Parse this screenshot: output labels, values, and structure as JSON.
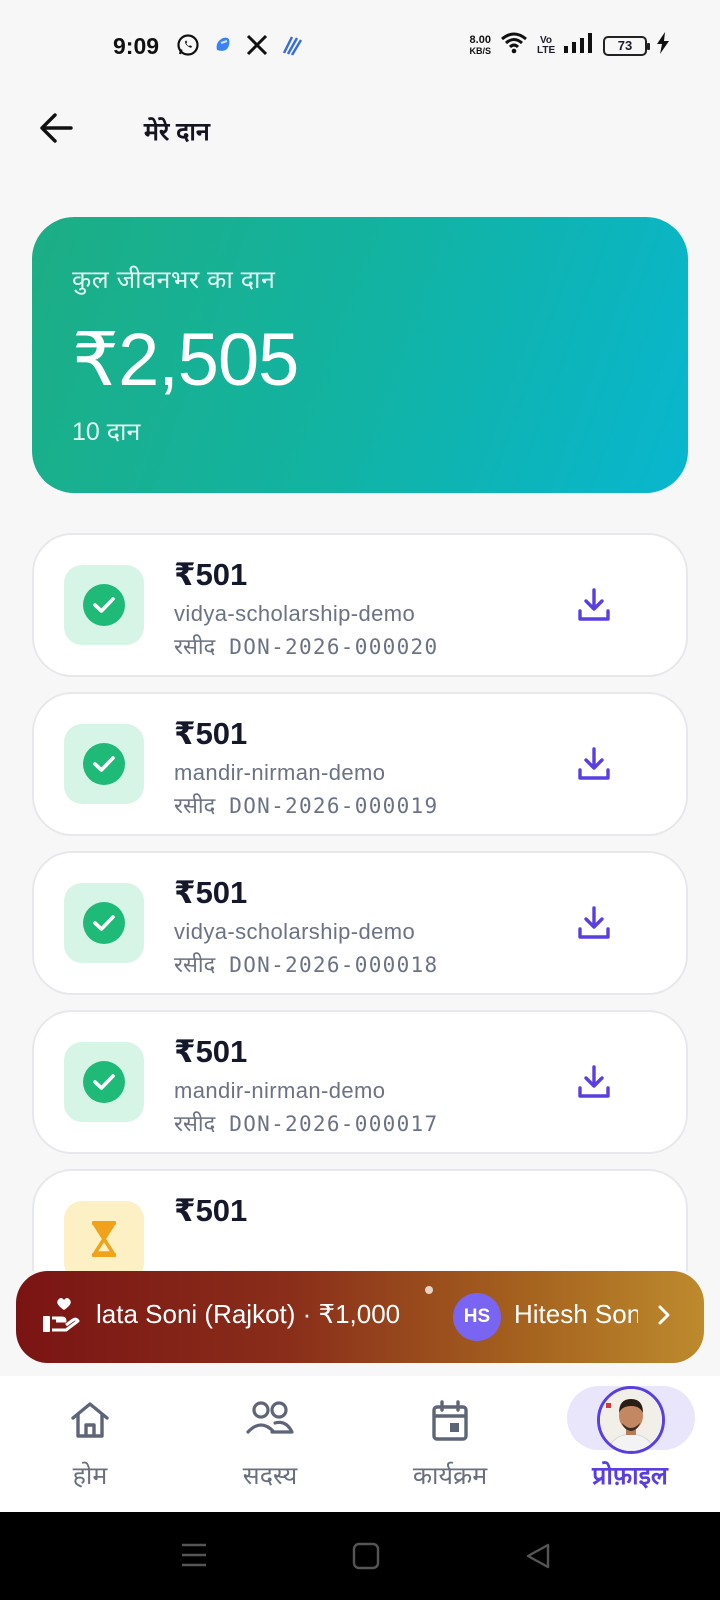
{
  "status_bar": {
    "time": "9:09",
    "net_speed_value": "8.00",
    "net_speed_unit": "KB/S",
    "volte": "Vo LTE",
    "battery": "73",
    "icons": [
      "whatsapp-icon",
      "app-icon",
      "x-icon",
      "signal-app-icon",
      "wifi-icon",
      "cellular-signal-icon",
      "charging-icon"
    ]
  },
  "header": {
    "title": "मेरे दान",
    "back_icon": "arrow-left-icon"
  },
  "summary": {
    "label": "कुल जीवनभर का दान",
    "amount": "₹2,505",
    "count": "10 दान"
  },
  "donations": [
    {
      "amount": "₹501",
      "slug": "vidya-scholarship-demo",
      "receipt_label": "रसीद",
      "receipt_no": "DON-2026-000020",
      "status": "success"
    },
    {
      "amount": "₹501",
      "slug": "mandir-nirman-demo",
      "receipt_label": "रसीद",
      "receipt_no": "DON-2026-000019",
      "status": "success"
    },
    {
      "amount": "₹501",
      "slug": "vidya-scholarship-demo",
      "receipt_label": "रसीद",
      "receipt_no": "DON-2026-000018",
      "status": "success"
    },
    {
      "amount": "₹501",
      "slug": "mandir-nirman-demo",
      "receipt_label": "रसीद",
      "receipt_no": "DON-2026-000017",
      "status": "success"
    },
    {
      "amount": "₹501",
      "status": "pending"
    }
  ],
  "ticker": {
    "text": "lata Soni (Rajkot) · ₹1,000",
    "avatar_initials": "HS",
    "name": "Hitesh Soni"
  },
  "bottom_nav": {
    "items": [
      {
        "label": "होम",
        "icon": "home-icon"
      },
      {
        "label": "सदस्य",
        "icon": "members-icon"
      },
      {
        "label": "कार्यक्रम",
        "icon": "calendar-icon"
      },
      {
        "label": "प्रोफ़ाइल",
        "icon": "profile-avatar",
        "active": true
      }
    ]
  },
  "colors": {
    "accent": "#5b3ee0",
    "success": "#1fb978",
    "card_gradient_start": "#1cae84",
    "card_gradient_end": "#08b6cf"
  }
}
